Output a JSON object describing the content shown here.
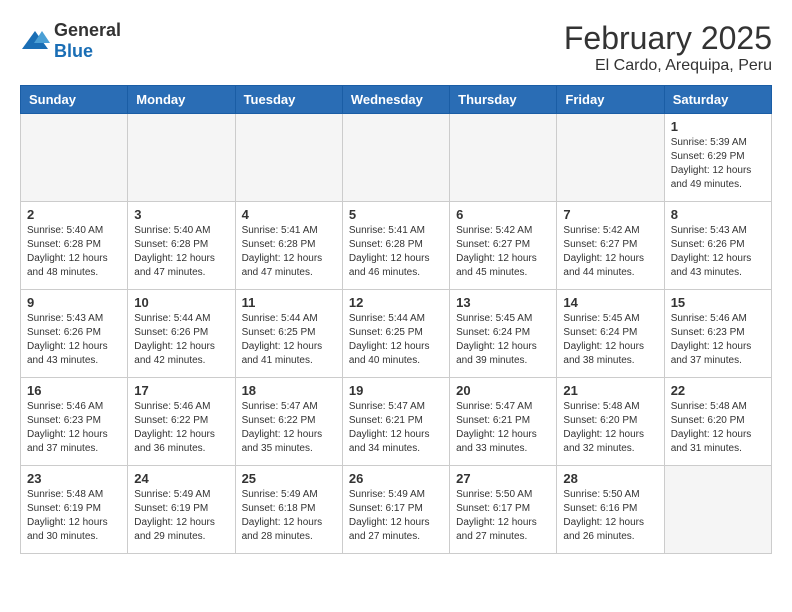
{
  "header": {
    "logo_general": "General",
    "logo_blue": "Blue",
    "month": "February 2025",
    "location": "El Cardo, Arequipa, Peru"
  },
  "weekdays": [
    "Sunday",
    "Monday",
    "Tuesday",
    "Wednesday",
    "Thursday",
    "Friday",
    "Saturday"
  ],
  "weeks": [
    [
      {
        "day": "",
        "empty": true
      },
      {
        "day": "",
        "empty": true
      },
      {
        "day": "",
        "empty": true
      },
      {
        "day": "",
        "empty": true
      },
      {
        "day": "",
        "empty": true
      },
      {
        "day": "",
        "empty": true
      },
      {
        "day": "1",
        "sunrise": "Sunrise: 5:39 AM",
        "sunset": "Sunset: 6:29 PM",
        "daylight": "Daylight: 12 hours and 49 minutes."
      }
    ],
    [
      {
        "day": "2",
        "sunrise": "Sunrise: 5:40 AM",
        "sunset": "Sunset: 6:28 PM",
        "daylight": "Daylight: 12 hours and 48 minutes."
      },
      {
        "day": "3",
        "sunrise": "Sunrise: 5:40 AM",
        "sunset": "Sunset: 6:28 PM",
        "daylight": "Daylight: 12 hours and 47 minutes."
      },
      {
        "day": "4",
        "sunrise": "Sunrise: 5:41 AM",
        "sunset": "Sunset: 6:28 PM",
        "daylight": "Daylight: 12 hours and 47 minutes."
      },
      {
        "day": "5",
        "sunrise": "Sunrise: 5:41 AM",
        "sunset": "Sunset: 6:28 PM",
        "daylight": "Daylight: 12 hours and 46 minutes."
      },
      {
        "day": "6",
        "sunrise": "Sunrise: 5:42 AM",
        "sunset": "Sunset: 6:27 PM",
        "daylight": "Daylight: 12 hours and 45 minutes."
      },
      {
        "day": "7",
        "sunrise": "Sunrise: 5:42 AM",
        "sunset": "Sunset: 6:27 PM",
        "daylight": "Daylight: 12 hours and 44 minutes."
      },
      {
        "day": "8",
        "sunrise": "Sunrise: 5:43 AM",
        "sunset": "Sunset: 6:26 PM",
        "daylight": "Daylight: 12 hours and 43 minutes."
      }
    ],
    [
      {
        "day": "9",
        "sunrise": "Sunrise: 5:43 AM",
        "sunset": "Sunset: 6:26 PM",
        "daylight": "Daylight: 12 hours and 43 minutes."
      },
      {
        "day": "10",
        "sunrise": "Sunrise: 5:44 AM",
        "sunset": "Sunset: 6:26 PM",
        "daylight": "Daylight: 12 hours and 42 minutes."
      },
      {
        "day": "11",
        "sunrise": "Sunrise: 5:44 AM",
        "sunset": "Sunset: 6:25 PM",
        "daylight": "Daylight: 12 hours and 41 minutes."
      },
      {
        "day": "12",
        "sunrise": "Sunrise: 5:44 AM",
        "sunset": "Sunset: 6:25 PM",
        "daylight": "Daylight: 12 hours and 40 minutes."
      },
      {
        "day": "13",
        "sunrise": "Sunrise: 5:45 AM",
        "sunset": "Sunset: 6:24 PM",
        "daylight": "Daylight: 12 hours and 39 minutes."
      },
      {
        "day": "14",
        "sunrise": "Sunrise: 5:45 AM",
        "sunset": "Sunset: 6:24 PM",
        "daylight": "Daylight: 12 hours and 38 minutes."
      },
      {
        "day": "15",
        "sunrise": "Sunrise: 5:46 AM",
        "sunset": "Sunset: 6:23 PM",
        "daylight": "Daylight: 12 hours and 37 minutes."
      }
    ],
    [
      {
        "day": "16",
        "sunrise": "Sunrise: 5:46 AM",
        "sunset": "Sunset: 6:23 PM",
        "daylight": "Daylight: 12 hours and 37 minutes."
      },
      {
        "day": "17",
        "sunrise": "Sunrise: 5:46 AM",
        "sunset": "Sunset: 6:22 PM",
        "daylight": "Daylight: 12 hours and 36 minutes."
      },
      {
        "day": "18",
        "sunrise": "Sunrise: 5:47 AM",
        "sunset": "Sunset: 6:22 PM",
        "daylight": "Daylight: 12 hours and 35 minutes."
      },
      {
        "day": "19",
        "sunrise": "Sunrise: 5:47 AM",
        "sunset": "Sunset: 6:21 PM",
        "daylight": "Daylight: 12 hours and 34 minutes."
      },
      {
        "day": "20",
        "sunrise": "Sunrise: 5:47 AM",
        "sunset": "Sunset: 6:21 PM",
        "daylight": "Daylight: 12 hours and 33 minutes."
      },
      {
        "day": "21",
        "sunrise": "Sunrise: 5:48 AM",
        "sunset": "Sunset: 6:20 PM",
        "daylight": "Daylight: 12 hours and 32 minutes."
      },
      {
        "day": "22",
        "sunrise": "Sunrise: 5:48 AM",
        "sunset": "Sunset: 6:20 PM",
        "daylight": "Daylight: 12 hours and 31 minutes."
      }
    ],
    [
      {
        "day": "23",
        "sunrise": "Sunrise: 5:48 AM",
        "sunset": "Sunset: 6:19 PM",
        "daylight": "Daylight: 12 hours and 30 minutes."
      },
      {
        "day": "24",
        "sunrise": "Sunrise: 5:49 AM",
        "sunset": "Sunset: 6:19 PM",
        "daylight": "Daylight: 12 hours and 29 minutes."
      },
      {
        "day": "25",
        "sunrise": "Sunrise: 5:49 AM",
        "sunset": "Sunset: 6:18 PM",
        "daylight": "Daylight: 12 hours and 28 minutes."
      },
      {
        "day": "26",
        "sunrise": "Sunrise: 5:49 AM",
        "sunset": "Sunset: 6:17 PM",
        "daylight": "Daylight: 12 hours and 27 minutes."
      },
      {
        "day": "27",
        "sunrise": "Sunrise: 5:50 AM",
        "sunset": "Sunset: 6:17 PM",
        "daylight": "Daylight: 12 hours and 27 minutes."
      },
      {
        "day": "28",
        "sunrise": "Sunrise: 5:50 AM",
        "sunset": "Sunset: 6:16 PM",
        "daylight": "Daylight: 12 hours and 26 minutes."
      },
      {
        "day": "",
        "empty": true
      }
    ]
  ]
}
